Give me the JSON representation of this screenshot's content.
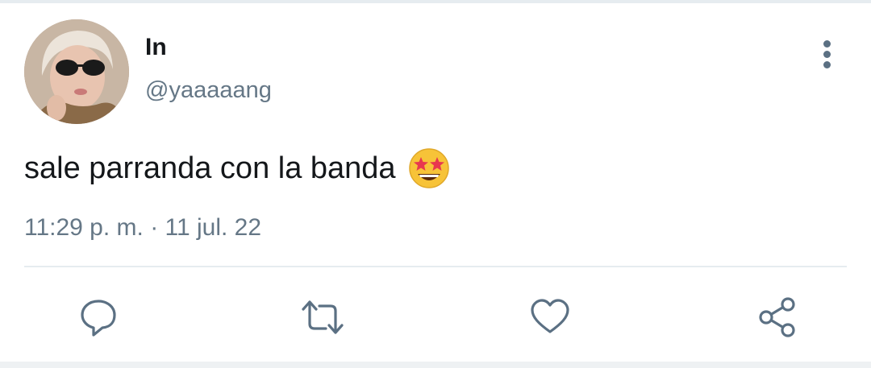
{
  "tweet": {
    "author": {
      "display_name": "In",
      "handle": "@yaaaaang",
      "avatar_icon": "profile-photo"
    },
    "text": "sale parranda con la banda",
    "emoji": "star-struck-emoji",
    "timestamp": "11:29 p. m. · 11 jul. 22"
  },
  "actions": [
    {
      "name": "reply",
      "icon": "reply-icon"
    },
    {
      "name": "retweet",
      "icon": "retweet-icon"
    },
    {
      "name": "like",
      "icon": "heart-icon"
    },
    {
      "name": "share",
      "icon": "share-icon"
    }
  ],
  "colors": {
    "text_primary": "#14171a",
    "text_secondary": "#657786",
    "icon": "#5b7083",
    "divider": "#e6ecf0"
  }
}
